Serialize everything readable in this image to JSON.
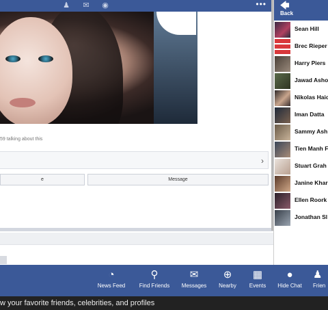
{
  "topbar": {
    "icons": [
      "friends-icon",
      "messages-icon",
      "globe-icon"
    ],
    "more": "•••"
  },
  "post": {
    "talking": "59 talking about this"
  },
  "actions": {
    "like_partial": "e",
    "message": "Message"
  },
  "sidebar": {
    "back_arrow": "🡄",
    "back_label": "Back",
    "friends": [
      {
        "name": "Sean Hill"
      },
      {
        "name": "Brec Rieper"
      },
      {
        "name": "Harry Piers"
      },
      {
        "name": "Jawad Asho"
      },
      {
        "name": "Nikolas Haic"
      },
      {
        "name": "Iman Datta"
      },
      {
        "name": "Sammy Ash"
      },
      {
        "name": "Tien Manh F"
      },
      {
        "name": "Stuart Grah"
      },
      {
        "name": "Janine Khar"
      },
      {
        "name": "Ellen Roork"
      },
      {
        "name": "Jonathan Sl"
      }
    ]
  },
  "taskbar": {
    "items": [
      {
        "label": "News Feed",
        "icon": "rss-icon",
        "glyph": "◔"
      },
      {
        "label": "Find Friends",
        "icon": "location-pin-icon",
        "glyph": "⚲"
      },
      {
        "label": "Messages",
        "icon": "envelope-icon",
        "glyph": "✉"
      },
      {
        "label": "Nearby",
        "icon": "target-icon",
        "glyph": "⊕"
      },
      {
        "label": "Events",
        "icon": "calendar-icon",
        "glyph": "▦"
      },
      {
        "label": "Hide Chat",
        "icon": "chat-bubble-icon",
        "glyph": "●"
      },
      {
        "label": "Frien",
        "icon": "person-icon",
        "glyph": "♟"
      }
    ]
  },
  "caption": "w your favorite friends, celebrities, and profiles",
  "colors": {
    "brand": "#3b5998",
    "caption_bg": "#222222"
  }
}
